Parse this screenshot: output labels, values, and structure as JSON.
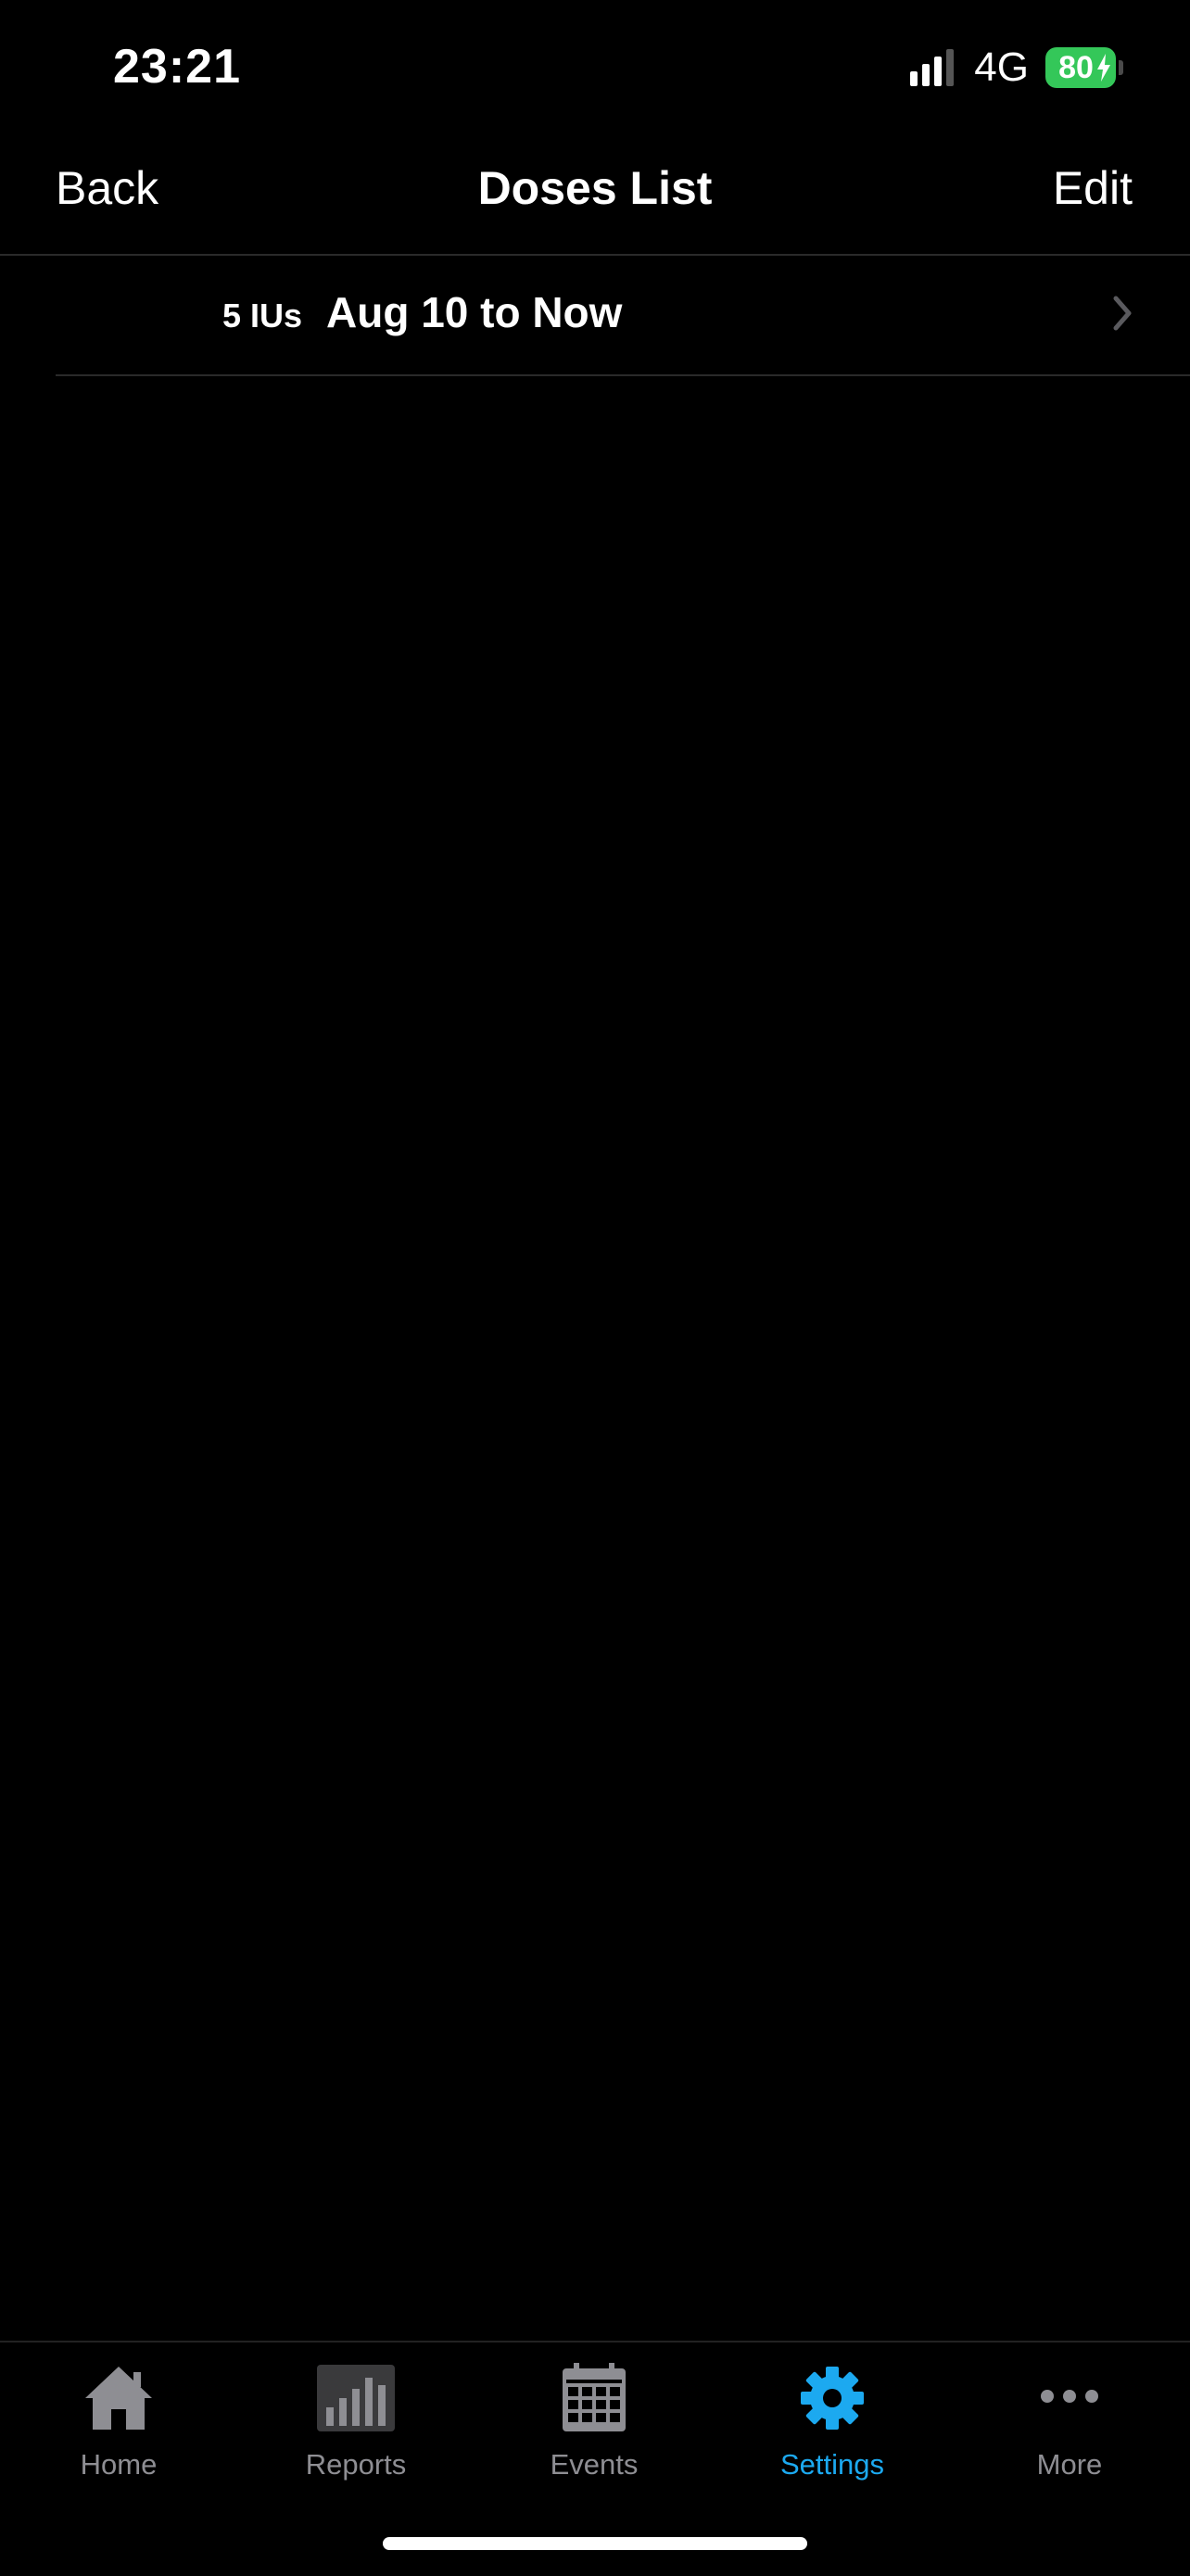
{
  "status_bar": {
    "time": "23:21",
    "network": "4G",
    "battery": "80",
    "signal_icon": "signal-bars-icon",
    "battery_icon": "battery-charging-icon"
  },
  "nav": {
    "back_label": "Back",
    "title": "Doses List",
    "edit_label": "Edit"
  },
  "doses": [
    {
      "amount": "5 IUs",
      "range": "Aug 10 to Now",
      "icon": "chevron-right-icon"
    }
  ],
  "tabs": [
    {
      "label": "Home",
      "icon": "home-icon",
      "active": false
    },
    {
      "label": "Reports",
      "icon": "bar-chart-icon",
      "active": false
    },
    {
      "label": "Events",
      "icon": "calendar-icon",
      "active": false
    },
    {
      "label": "Settings",
      "icon": "gear-icon",
      "active": true
    },
    {
      "label": "More",
      "icon": "more-dots-icon",
      "active": false
    }
  ],
  "colors": {
    "background": "#000000",
    "active_tab": "#1ca9f0",
    "inactive_tab": "#8e8e93",
    "battery": "#34c759"
  }
}
